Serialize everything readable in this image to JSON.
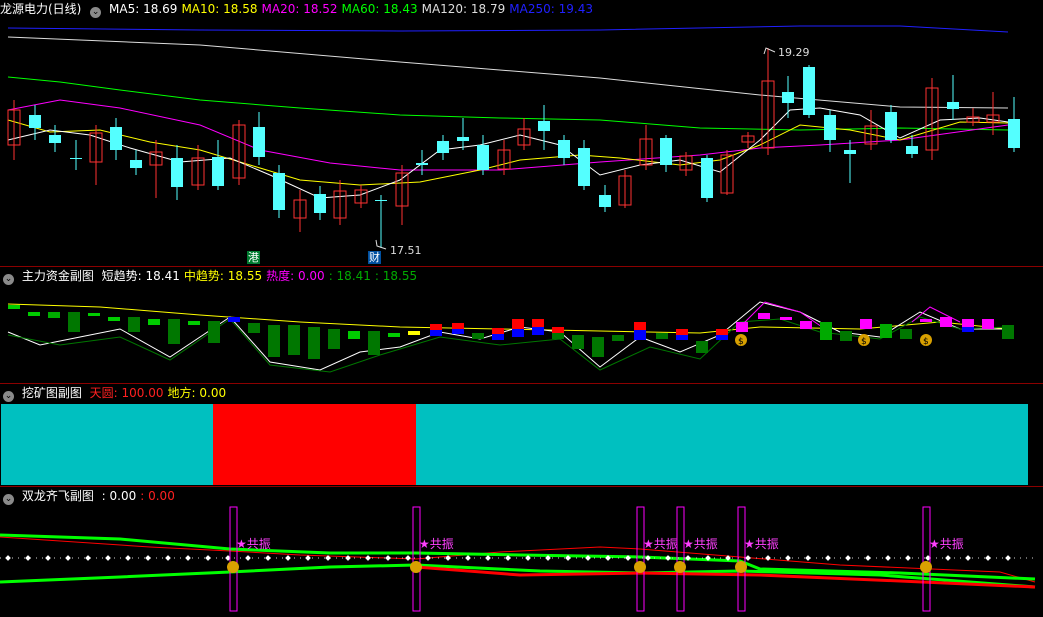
{
  "main": {
    "title": "龙源电力(日线)",
    "indicators": [
      {
        "label": "MA5: 18.69",
        "color": "#ffffff"
      },
      {
        "label": "MA10: 18.58",
        "color": "#ffff00"
      },
      {
        "label": "MA20: 18.52",
        "color": "#ff00ff"
      },
      {
        "label": "MA60: 18.43",
        "color": "#00ff00"
      },
      {
        "label": "MA120: 18.79",
        "color": "#dddddd"
      },
      {
        "label": "MA250: 19.43",
        "color": "#2020ff"
      }
    ],
    "high_label": "19.29",
    "low_label": "17.51",
    "tag_gang": "港",
    "tag_cai": "财",
    "colors": {
      "up": "#ff3232",
      "down": "#54ffff"
    }
  },
  "fund": {
    "title": "主力资金副图",
    "items": [
      {
        "label": "短趋势: 18.41",
        "color": "#ffffff"
      },
      {
        "label": "中趋势: 18.55",
        "color": "#ffff00"
      },
      {
        "label": "热度: 0.00",
        "color": "#ff00ff"
      },
      {
        "label": ": 18.41",
        "color": "#00aa00"
      },
      {
        "label": ": 18.55",
        "color": "#00aa00"
      }
    ]
  },
  "mining": {
    "title": "挖矿图副图",
    "items": [
      {
        "label": "天圆: 100.00",
        "color": "#ff2020"
      },
      {
        "label": "地方: 0.00",
        "color": "#ffff00"
      }
    ],
    "colors": {
      "a": "#00c0c0",
      "b": "#ff0000"
    }
  },
  "dragon": {
    "title": "双龙齐飞副图",
    "items": [
      {
        "label": ": 0.00",
        "color": "#ffffff"
      },
      {
        "label": ": 0.00",
        "color": "#ff2020"
      }
    ],
    "signal_text": "★共振"
  }
}
